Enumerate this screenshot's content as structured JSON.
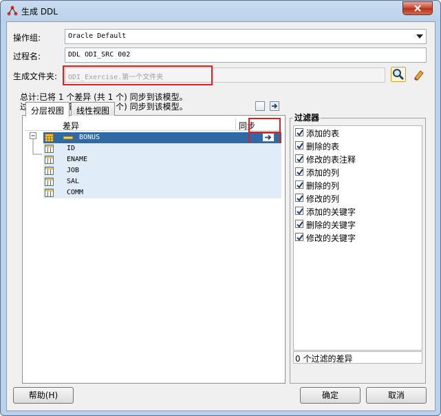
{
  "window": {
    "title": "生成 DDL"
  },
  "form": {
    "operation_group_label": "操作组:",
    "operation_group_value": "Oracle Default",
    "process_name_label": "过程名:",
    "process_name_value": "DDL ODI_SRC 002",
    "generate_folder_label": "生成文件夹:",
    "generate_folder_value": "ODI_Exercise.第一个文件夹"
  },
  "summary": {
    "total_line": "总计:已将 1 个差异 (共 1 个) 同步到该模型。",
    "filter_line": "过滤:已将 1 个差异 (共 1 个) 同步到该模型。"
  },
  "tabs": [
    {
      "label": "分层视图",
      "active": true
    },
    {
      "label": "线性视图",
      "active": false
    }
  ],
  "grid": {
    "col_diff": "差异",
    "col_sync": "同步",
    "table_row": {
      "name": "BONUS"
    },
    "columns": [
      "ID",
      "ENAME",
      "JOB",
      "SAL",
      "COMM"
    ]
  },
  "filter": {
    "title": "过滤器",
    "items": [
      "添加的表",
      "删除的表",
      "修改的表注释",
      "添加的列",
      "删除的列",
      "修改的列",
      "添加的关键字",
      "删除的关键字",
      "修改的关键字"
    ],
    "status": "0 个过滤的差异"
  },
  "buttons": {
    "help": "帮助(H)",
    "ok": "确定",
    "cancel": "取消"
  },
  "colors": {
    "selected_row": "#2f6aa6",
    "child_row": "#e0ecf8",
    "highlight_box": "#e02020"
  },
  "icons": [
    "odi-app-icon",
    "close-icon",
    "search-icon",
    "eraser-icon",
    "sync-arrow-icon",
    "table-icon",
    "column-icon",
    "checkbox-checked-icon"
  ]
}
